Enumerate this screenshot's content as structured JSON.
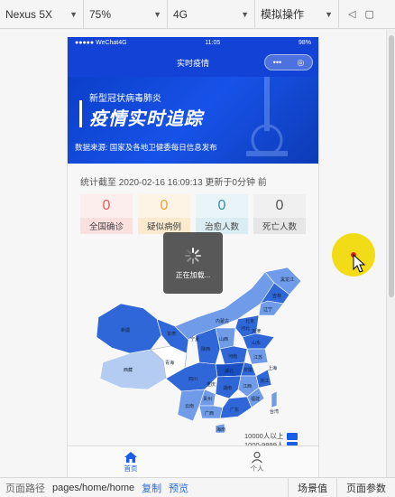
{
  "toolbar": {
    "device": "Nexus 5X",
    "zoom": "75%",
    "network": "4G",
    "mode": "模拟操作"
  },
  "status_bar": {
    "carrier": "●●●●● WeChat4G",
    "time": "11:05",
    "battery": "98%"
  },
  "nav": {
    "title": "实时疫情",
    "capsule_more": "•••",
    "capsule_close": "◎"
  },
  "banner": {
    "subtitle": "新型冠状病毒肺炎",
    "title": "疫情实时追踪",
    "source": "数据来源: 国家及各地卫健委每日信息发布"
  },
  "stats": {
    "time_prefix": "统计截至",
    "time": "2020-02-16 16:09:13",
    "update_prefix": "更新于",
    "update": "0分钟",
    "update_suffix": "前",
    "cards": [
      {
        "value": "0",
        "label": "全国确诊"
      },
      {
        "value": "0",
        "label": "疑似病例"
      },
      {
        "value": "0",
        "label": "治愈人数"
      },
      {
        "value": "0",
        "label": "死亡人数"
      }
    ]
  },
  "loading": {
    "text": "正在加载..."
  },
  "map": {
    "labels": [
      "新疆",
      "西藏",
      "青海",
      "甘肃",
      "内蒙古",
      "四川",
      "云南",
      "广西",
      "广东",
      "湖南",
      "湖北",
      "河南",
      "山东",
      "江苏",
      "浙江",
      "江西",
      "福建",
      "安徽",
      "山西",
      "陕西",
      "河北",
      "北京",
      "辽宁",
      "吉林",
      "黑龙江",
      "贵州",
      "重庆",
      "海南",
      "宁夏",
      "天津",
      "上海",
      "台湾"
    ]
  },
  "legend": {
    "items": [
      "10000人以上",
      "1000-9999人"
    ]
  },
  "tabbar": {
    "home": "首页",
    "profile": "个人"
  },
  "bottombar": {
    "path_label": "页面路径",
    "path": "pages/home/home",
    "copy": "复制",
    "preview": "预览",
    "scene": "场景值",
    "params": "页面参数"
  },
  "colors": {
    "primary": "#1243d6",
    "map_dark": "#2f66d8",
    "map_mid": "#6f9be8",
    "map_light": "#b5ccf2",
    "cursor": "#f2d900"
  }
}
